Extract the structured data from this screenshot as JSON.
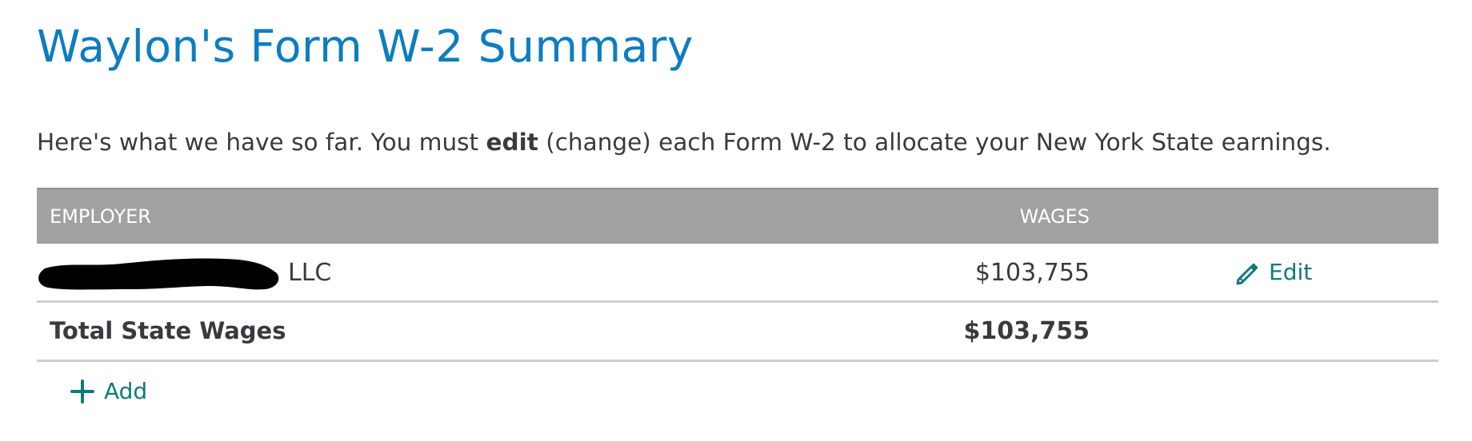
{
  "page": {
    "title": "Waylon's Form W-2 Summary",
    "intro_before": "Here's what we have so far. You must ",
    "intro_bold": "edit",
    "intro_after": " (change) each Form W-2 to allocate your New York State earnings."
  },
  "table": {
    "headers": {
      "employer": "EMPLOYER",
      "wages": "WAGES"
    },
    "rows": [
      {
        "employer_visible_suffix": "LLC",
        "wages": "$103,755",
        "action_label": "Edit",
        "action_icon": "pencil-icon"
      }
    ],
    "total": {
      "label": "Total State Wages",
      "value": "$103,755"
    }
  },
  "actions": {
    "add_label": "Add",
    "add_icon": "plus-icon"
  },
  "colors": {
    "title": "#0d7dc1",
    "link": "#0e7a7a",
    "header_bg": "#a1a1a1",
    "text": "#393a3d",
    "redaction": "#000000"
  }
}
